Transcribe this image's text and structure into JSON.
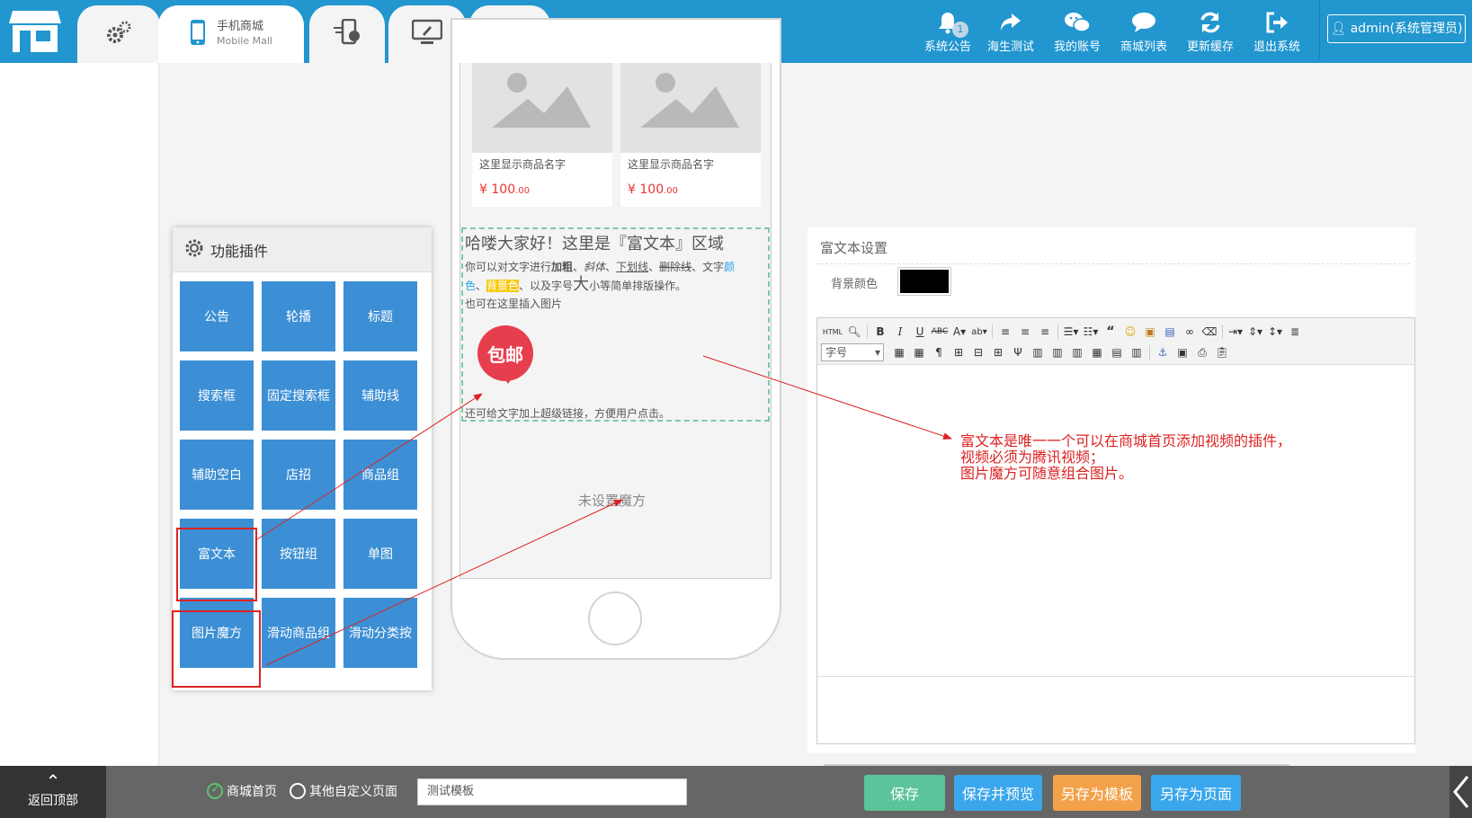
{
  "header": {
    "tabs": [
      {
        "id": "settings",
        "icon": "gears-icon"
      },
      {
        "id": "mobile-mall",
        "icon": "mobile-phone-icon",
        "label": "手机商城",
        "sublabel": "Mobile Mall"
      },
      {
        "id": "phone-cart",
        "icon": "phone-cart-icon"
      },
      {
        "id": "desktop",
        "icon": "monitor-icon"
      },
      {
        "id": "award",
        "icon": "medal-icon"
      }
    ],
    "nav": [
      {
        "label": "系统公告",
        "icon": "bell-icon",
        "badge": "1"
      },
      {
        "label": "海生测试",
        "icon": "share-arrow-icon"
      },
      {
        "label": "我的账号",
        "icon": "wechat-icon"
      },
      {
        "label": "商城列表",
        "icon": "chat-bubbles-icon"
      },
      {
        "label": "更新缓存",
        "icon": "refresh-icon"
      },
      {
        "label": "退出系统",
        "icon": "logout-icon"
      }
    ],
    "admin": "admin(系统管理员)"
  },
  "plugins": {
    "title": "功能插件",
    "items": [
      "公告",
      "轮播",
      "标题",
      "搜索框",
      "固定搜索框",
      "辅助线",
      "辅助空白",
      "店招",
      "商品组",
      "富文本",
      "按钮组",
      "单图",
      "图片魔方",
      "滑动商品组",
      "滑动分类按"
    ]
  },
  "phone": {
    "products": [
      {
        "name": "这里显示商品名字",
        "price_symbol": "¥",
        "price_int": "100",
        "price_dec": ".00"
      },
      {
        "name": "这里显示商品名字",
        "price_symbol": "¥",
        "price_int": "100",
        "price_dec": ".00"
      }
    ],
    "richtext": {
      "title": "哈喽大家好！这里是『富文本』区域",
      "line1_a": "你可以对文字进行",
      "bold": "加粗",
      "sep1": "、",
      "italic": "斜体",
      "sep2": "、",
      "underline": "下划线",
      "sep3": "、",
      "strike": "删除线",
      "sep4": "、文字",
      "color_word_1": "颜",
      "color_word_2": "色",
      "sep5": "、",
      "bg_word": "背景色",
      "line2_b": "、以及字号",
      "big": "大",
      "line2_c": "小等简单排版操作。",
      "line3": "也可在这里插入图片",
      "badge": "包邮",
      "bottom": "还可给文字加上超级链接，方便用户点击。"
    },
    "mofang": "未设置魔方"
  },
  "editor": {
    "title": "富文本设置",
    "bg_label": "背景颜色",
    "bg_color": "#000000",
    "font_size_select": "字号",
    "toolbar_html": "HTML"
  },
  "annotation": {
    "line1": "富文本是唯一一个可以在商城首页添加视频的插件，",
    "line2": "视频必须为腾讯视频；",
    "line3": "图片魔方可随意组合图片。"
  },
  "footer": {
    "back_top": "返回顶部",
    "page_options": [
      "商城首页",
      "其他自定义页面"
    ],
    "template_name": "测试模板",
    "buttons": [
      {
        "label": "保存",
        "color": "#5cc49a"
      },
      {
        "label": "保存并预览",
        "color": "#3aa6ec"
      },
      {
        "label": "另存为模板",
        "color": "#f3a24a"
      },
      {
        "label": "另存为页面",
        "color": "#3aa6ec"
      }
    ]
  },
  "colors": {
    "primary": "#2196cf",
    "plugin": "#3c8fd4",
    "annotation": "#d22222"
  }
}
